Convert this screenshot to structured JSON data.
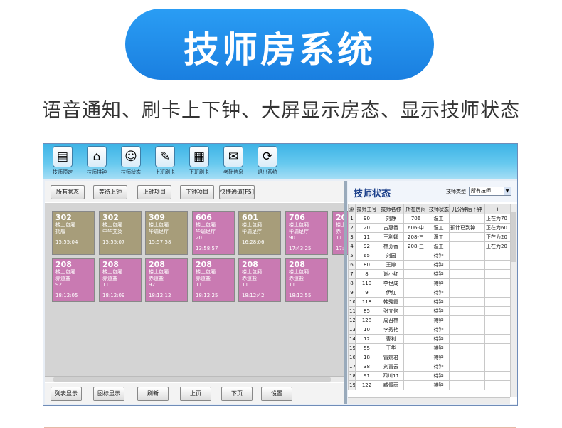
{
  "banner": {
    "title": "技师房系统"
  },
  "subtitle": "语音通知、刷卡上下钟、大屏显示房态、显示技师状态",
  "toolbar": [
    {
      "label": "技师预定",
      "icon": "book-icon",
      "glyph": "▤"
    },
    {
      "label": "技师排钟",
      "icon": "home-icon",
      "glyph": "⌂"
    },
    {
      "label": "技师状态",
      "icon": "person-icon",
      "glyph": "☺"
    },
    {
      "label": "上班刷卡",
      "icon": "pencil-icon",
      "glyph": "✎"
    },
    {
      "label": "下班刷卡",
      "icon": "document-icon",
      "glyph": "▦"
    },
    {
      "label": "考勤信息",
      "icon": "chat-icon",
      "glyph": "✉"
    },
    {
      "label": "退出系统",
      "icon": "exit-icon",
      "glyph": "⟳"
    }
  ],
  "top_buttons": [
    "所有状态",
    "等待上钟",
    "上钟项目",
    "下钟项目",
    "快捷通道[F5]"
  ],
  "rooms": [
    {
      "num": "302",
      "l1": "楼上包厢",
      "l2": "扬履",
      "l3": "",
      "time": "15:55:04",
      "color": "olive"
    },
    {
      "num": "302",
      "l1": "楼上包厢",
      "l2": "中华艾灸",
      "l3": "",
      "time": "15:55:07",
      "color": "olive"
    },
    {
      "num": "309",
      "l1": "楼上包厢",
      "l2": "华瑜足疗",
      "l3": "",
      "time": "15:57:58",
      "color": "olive"
    },
    {
      "num": "606",
      "l1": "楼上包厢",
      "l2": "华瑜足疗",
      "l3": "20",
      "time": "13:58:57",
      "color": "pink"
    },
    {
      "num": "601",
      "l1": "楼上包厢",
      "l2": "华瑜足疗",
      "l3": "",
      "time": "16:28:06",
      "color": "olive"
    },
    {
      "num": "706",
      "l1": "楼上包厢",
      "l2": "华瑜足疗",
      "l3": "90",
      "time": "17:43:25",
      "color": "pink"
    },
    {
      "num": "20",
      "l1": "楼上",
      "l2": "赤",
      "l3": "11",
      "time": "17:5",
      "color": "pink"
    },
    {
      "num": "208",
      "l1": "楼上包厢",
      "l2": "赤道盐",
      "l3": "92",
      "time": "18:12:05",
      "color": "pink"
    },
    {
      "num": "208",
      "l1": "楼上包厢",
      "l2": "赤道盐",
      "l3": "11",
      "time": "18:12:09",
      "color": "pink"
    },
    {
      "num": "208",
      "l1": "楼上包厢",
      "l2": "赤道盐",
      "l3": "92",
      "time": "18:12:12",
      "color": "pink"
    },
    {
      "num": "208",
      "l1": "楼上包厢",
      "l2": "赤道盐",
      "l3": "11",
      "time": "18:12:25",
      "color": "pink"
    },
    {
      "num": "208",
      "l1": "楼上包厢",
      "l2": "赤道盐",
      "l3": "11",
      "time": "18:12:42",
      "color": "pink"
    },
    {
      "num": "208",
      "l1": "楼上包厢",
      "l2": "赤道盐",
      "l3": "11",
      "time": "18:12:55",
      "color": "pink"
    }
  ],
  "bottom_buttons": [
    "列表显示",
    "图标显示",
    "刷新",
    "上页",
    "下页",
    "设置"
  ],
  "right": {
    "title": "技师状态",
    "type_label": "技师类型",
    "type_value": "所有技师",
    "columns": [
      "淵",
      "技师工号",
      "技师名称",
      "所在房间",
      "技师状态",
      "几分钟后下钟",
      "i"
    ],
    "rows": [
      [
        "1",
        "90",
        "刘静",
        "706",
        "湿工",
        "",
        "正在为70"
      ],
      [
        "2",
        "20",
        "古惠香",
        "606-中",
        "湿工",
        "预计已到钟",
        "正在为60"
      ],
      [
        "3",
        "11",
        "王利娜",
        "208-三",
        "湿工",
        "",
        "正在为20"
      ],
      [
        "4",
        "92",
        "林芬香",
        "208-三",
        "湿工",
        "",
        "正在为20"
      ],
      [
        "5",
        "65",
        "刘园",
        "",
        "待钟",
        "",
        ""
      ],
      [
        "6",
        "80",
        "王婷",
        "",
        "待钟",
        "",
        ""
      ],
      [
        "7",
        "8",
        "谢小红",
        "",
        "待钟",
        "",
        ""
      ],
      [
        "8",
        "110",
        "李世成",
        "",
        "待钟",
        "",
        ""
      ],
      [
        "9",
        "9",
        "伊红",
        "",
        "待钟",
        "",
        ""
      ],
      [
        "10",
        "118",
        "韩秀霞",
        "",
        "待钟",
        "",
        ""
      ],
      [
        "11",
        "85",
        "张立何",
        "",
        "待钟",
        "",
        ""
      ],
      [
        "12",
        "128",
        "周召林",
        "",
        "待钟",
        "",
        ""
      ],
      [
        "13",
        "10",
        "李秀艳",
        "",
        "待钟",
        "",
        ""
      ],
      [
        "14",
        "12",
        "曹利",
        "",
        "待钟",
        "",
        ""
      ],
      [
        "15",
        "55",
        "王华",
        "",
        "待钟",
        "",
        ""
      ],
      [
        "16",
        "18",
        "雷婉君",
        "",
        "待钟",
        "",
        ""
      ],
      [
        "17",
        "38",
        "刘喜云",
        "",
        "待钟",
        "",
        ""
      ],
      [
        "18",
        "91",
        "四川11",
        "",
        "待钟",
        "",
        ""
      ],
      [
        "19",
        "122",
        "臧佩雨",
        "",
        "待钟",
        "",
        ""
      ]
    ]
  }
}
